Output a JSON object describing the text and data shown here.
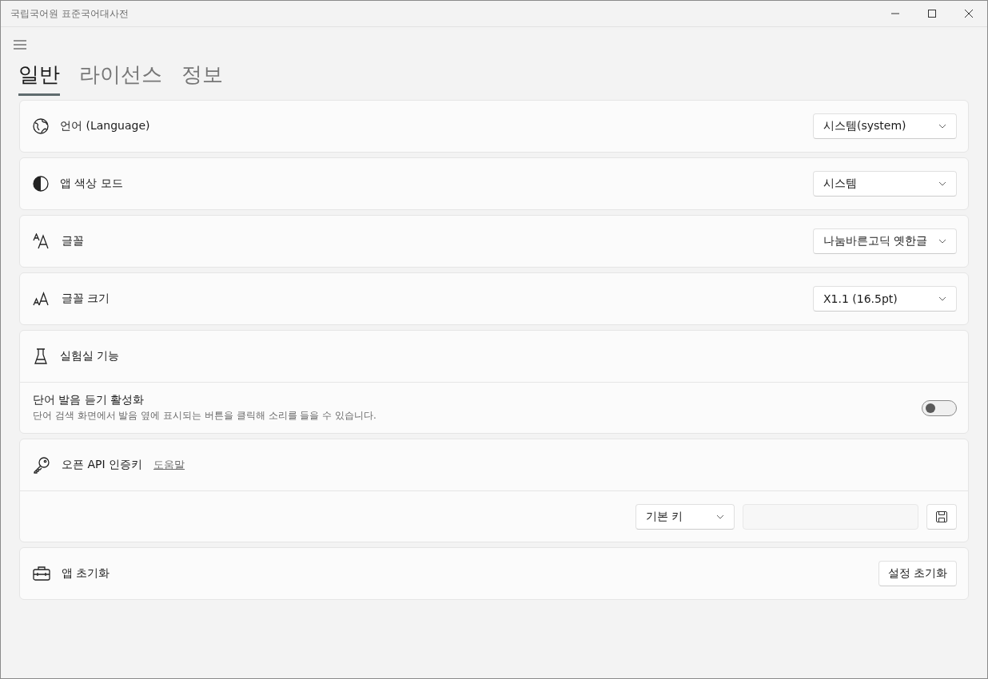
{
  "window": {
    "title": "국립국어원 표준국어대사전"
  },
  "tabs": [
    {
      "label": "일반",
      "selected": true
    },
    {
      "label": "라이선스",
      "selected": false
    },
    {
      "label": "정보",
      "selected": false
    }
  ],
  "cards": [
    {
      "kind": "dropdown",
      "label": "언어 (Language)",
      "value": "시스템(system)"
    },
    {
      "kind": "dropdown",
      "label": "앱 색상 모드",
      "value": "시스템"
    },
    {
      "kind": "dropdown",
      "label": "글꼴",
      "value": "나눔바른고딕 옛한글"
    },
    {
      "kind": "dropdown",
      "label": "글꼴 크기",
      "value": "X1.1 (16.5pt)"
    },
    {
      "kind": "toggle",
      "label": "실험실 기능",
      "option": {
        "title": "단어 발음 듣기 활성화",
        "description": "단어 검색 화면에서 발음 옆에 표시되는 버튼을 클릭해 소리를 들을 수 있습니다.",
        "on": false
      }
    },
    {
      "kind": "apikey",
      "label": "오픈 API 인증키",
      "link": "도움말",
      "key_type": "기본 키"
    },
    {
      "kind": "button",
      "label": "앱 초기화",
      "button": "설정 초기화"
    }
  ]
}
